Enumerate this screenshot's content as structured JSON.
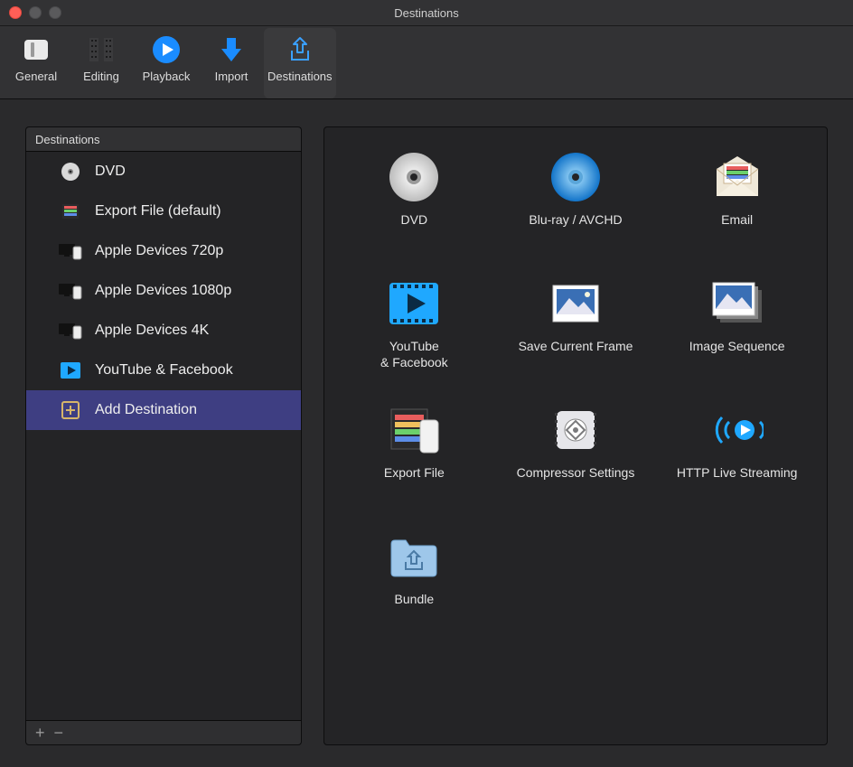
{
  "window": {
    "title": "Destinations"
  },
  "toolbar": {
    "items": [
      {
        "id": "general",
        "label": "General"
      },
      {
        "id": "editing",
        "label": "Editing"
      },
      {
        "id": "playback",
        "label": "Playback"
      },
      {
        "id": "import",
        "label": "Import"
      },
      {
        "id": "destinations",
        "label": "Destinations",
        "active": true
      }
    ]
  },
  "sidebar": {
    "header": "Destinations",
    "items": [
      {
        "icon": "dvd",
        "label": "DVD"
      },
      {
        "icon": "exportfile",
        "label": "Export File (default)"
      },
      {
        "icon": "appledev",
        "label": "Apple Devices 720p"
      },
      {
        "icon": "appledev",
        "label": "Apple Devices 1080p"
      },
      {
        "icon": "appledev",
        "label": "Apple Devices 4K"
      },
      {
        "icon": "youtube",
        "label": "YouTube & Facebook"
      },
      {
        "icon": "adddest",
        "label": "Add Destination",
        "selected": true
      }
    ],
    "footer": {
      "add": "+",
      "remove": "−"
    }
  },
  "gallery": {
    "items": [
      {
        "icon": "dvd-large",
        "label": "DVD"
      },
      {
        "icon": "bluray",
        "label": "Blu-ray / AVCHD"
      },
      {
        "icon": "email",
        "label": "Email"
      },
      {
        "icon": "youtube-large",
        "label": "YouTube\n& Facebook"
      },
      {
        "icon": "saveframe",
        "label": "Save Current Frame"
      },
      {
        "icon": "imageseq",
        "label": "Image Sequence"
      },
      {
        "icon": "exportfile-lg",
        "label": "Export File"
      },
      {
        "icon": "compressor",
        "label": "Compressor Settings"
      },
      {
        "icon": "hls",
        "label": "HTTP Live Streaming"
      },
      {
        "icon": "bundle",
        "label": "Bundle"
      }
    ]
  }
}
